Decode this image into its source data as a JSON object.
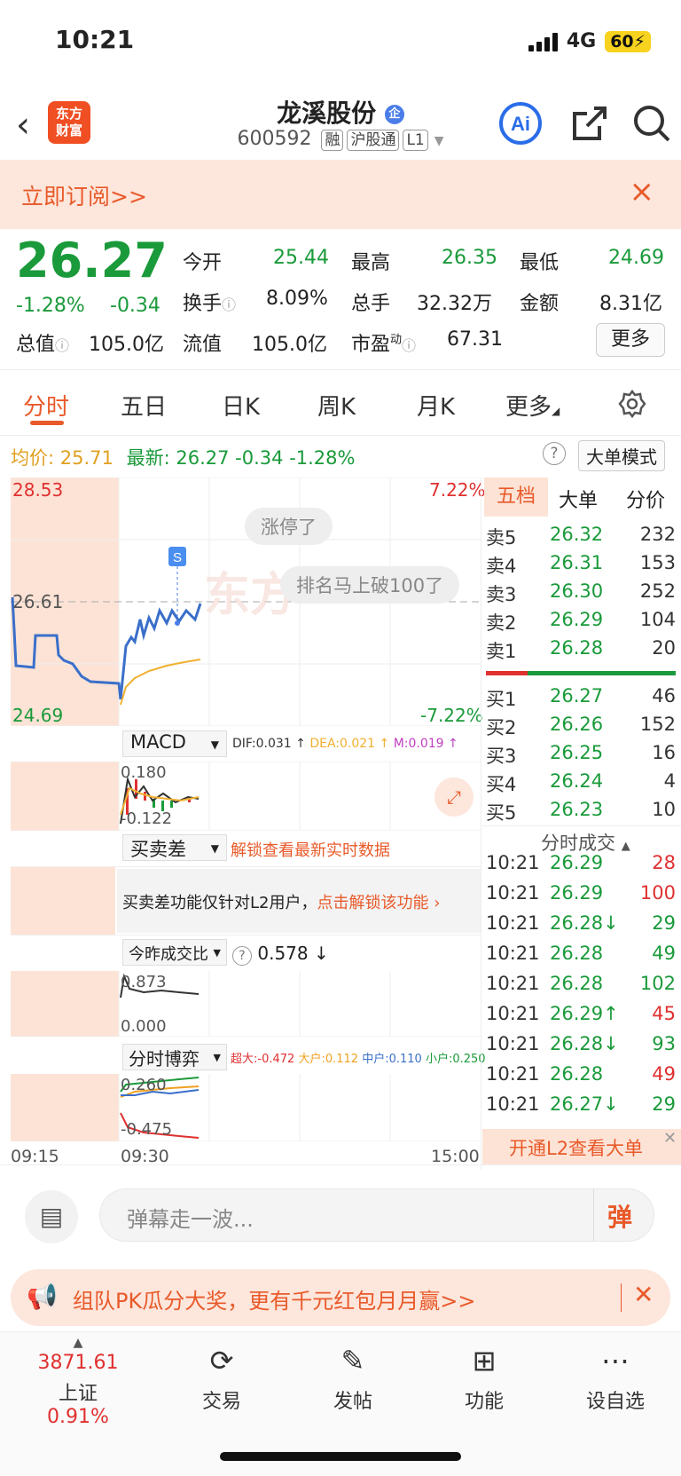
{
  "status": {
    "time": "10:21",
    "network": "4G",
    "battery": "60"
  },
  "header": {
    "logo_line1": "东方",
    "logo_line2": "财富",
    "name": "龙溪股份",
    "name_badge": "企",
    "code": "600592",
    "tags": [
      "融",
      "沪股通",
      "L1"
    ]
  },
  "banner": {
    "text": "立即订阅>>",
    "close": "×"
  },
  "quote": {
    "price": "26.27",
    "change_pct": "-1.28%",
    "change": "-0.34",
    "open_label": "今开",
    "open": "25.44",
    "high_label": "最高",
    "high": "26.35",
    "low_label": "最低",
    "low": "24.69",
    "turnover_label": "换手",
    "turnover": "8.09%",
    "volume_label": "总手",
    "volume": "32.32万",
    "amount_label": "金额",
    "amount": "8.31亿",
    "mktcap_label": "总值",
    "mktcap": "105.0亿",
    "float_label": "流值",
    "float": "105.0亿",
    "pe_label": "市盈",
    "pe_sup": "动",
    "pe": "67.31",
    "more": "更多"
  },
  "tabs": [
    "分时",
    "五日",
    "日K",
    "周K",
    "月K",
    "更多"
  ],
  "info_line": {
    "avg_label": "均价:",
    "avg": "25.71",
    "last_label": "最新:",
    "last": "26.27",
    "chg": "-0.34",
    "pct": "-1.28%",
    "mode": "大单模式"
  },
  "chart": {
    "y_top": "28.53",
    "y_mid": "26.61",
    "y_bottom": "24.69",
    "pct_top": "7.22%",
    "pct_bottom": "-7.22%",
    "bubble1": "涨停了",
    "bubble2": "排名马上破100了",
    "marker": "S",
    "time_start": "09:15",
    "time_mid": "09:30",
    "time_end": "15:00"
  },
  "macd": {
    "label": "MACD",
    "dif": "DIF:0.031",
    "dea": "DEA:0.021",
    "m": "M:0.019",
    "top": "0.180",
    "bottom": "-0.122"
  },
  "mmc": {
    "label": "买卖差",
    "unlock": "解锁查看最新实时数据",
    "notice": "买卖差功能仅针对L2用户，",
    "notice_link": "点击解锁该功能"
  },
  "ratio": {
    "label": "今昨成交比",
    "value": "0.578",
    "top": "0.873",
    "bottom": "0.000"
  },
  "game": {
    "label": "分时博弈",
    "big": "超大:-0.472",
    "large": "大户:0.112",
    "mid": "中户:0.110",
    "small": "小户:0.250",
    "top": "0.260",
    "bottom": "-0.475"
  },
  "side_tabs": [
    "五档",
    "大单",
    "分价"
  ],
  "asks": [
    {
      "label": "卖5",
      "price": "26.32",
      "vol": "232"
    },
    {
      "label": "卖4",
      "price": "26.31",
      "vol": "153"
    },
    {
      "label": "卖3",
      "price": "26.30",
      "vol": "252"
    },
    {
      "label": "卖2",
      "price": "26.29",
      "vol": "104"
    },
    {
      "label": "卖1",
      "price": "26.28",
      "vol": "20"
    }
  ],
  "bids": [
    {
      "label": "买1",
      "price": "26.27",
      "vol": "46"
    },
    {
      "label": "买2",
      "price": "26.26",
      "vol": "152"
    },
    {
      "label": "买3",
      "price": "26.25",
      "vol": "16"
    },
    {
      "label": "买4",
      "price": "26.24",
      "vol": "4"
    },
    {
      "label": "买5",
      "price": "26.23",
      "vol": "10"
    }
  ],
  "trades_title": "分时成交",
  "trades": [
    {
      "t": "10:21",
      "p": "26.29",
      "v": "28",
      "c": "red"
    },
    {
      "t": "10:21",
      "p": "26.29",
      "v": "100",
      "c": "red"
    },
    {
      "t": "10:21",
      "p": "26.28↓",
      "v": "29",
      "c": "green"
    },
    {
      "t": "10:21",
      "p": "26.28",
      "v": "49",
      "c": "green"
    },
    {
      "t": "10:21",
      "p": "26.28",
      "v": "102",
      "c": "green"
    },
    {
      "t": "10:21",
      "p": "26.29↑",
      "v": "45",
      "c": "red"
    },
    {
      "t": "10:21",
      "p": "26.28↓",
      "v": "93",
      "c": "green"
    },
    {
      "t": "10:21",
      "p": "26.28",
      "v": "49",
      "c": "red"
    },
    {
      "t": "10:21",
      "p": "26.27↓",
      "v": "29",
      "c": "green"
    }
  ],
  "l2_cta": "开通L2查看大单",
  "comment": {
    "placeholder": "弹幕走一波...",
    "send": "弹"
  },
  "promo": {
    "text": "组队PK瓜分大奖，更有千元红包月月赢>>"
  },
  "bottom": {
    "index_value": "3871.61",
    "index_name": "上证",
    "index_pct": "0.91%",
    "items": [
      "交易",
      "发帖",
      "功能",
      "设自选"
    ]
  }
}
